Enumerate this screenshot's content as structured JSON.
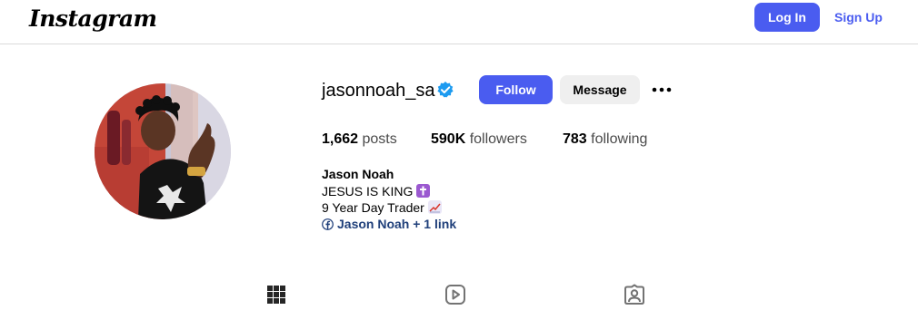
{
  "header": {
    "logo": "Instagram",
    "login_label": "Log In",
    "signup_label": "Sign Up"
  },
  "profile": {
    "username": "jasonnoah_sa",
    "verified": true,
    "follow_label": "Follow",
    "message_label": "Message",
    "stats": {
      "posts_count": "1,662",
      "posts_label": "posts",
      "followers_count": "590K",
      "followers_label": "followers",
      "following_count": "783",
      "following_label": "following"
    },
    "full_name": "Jason Noah",
    "bio_lines": [
      "JESUS IS KING",
      "9 Year Day Trader"
    ],
    "link_text": "Jason Noah + 1 link"
  },
  "tabs": [
    {
      "icon": "grid-icon"
    },
    {
      "icon": "reels-icon"
    },
    {
      "icon": "tagged-icon"
    }
  ],
  "colors": {
    "accent": "#4a5cf0",
    "verified": "#1d9bf0",
    "link": "#1f3f7a",
    "divider": "#dbdbdb"
  }
}
